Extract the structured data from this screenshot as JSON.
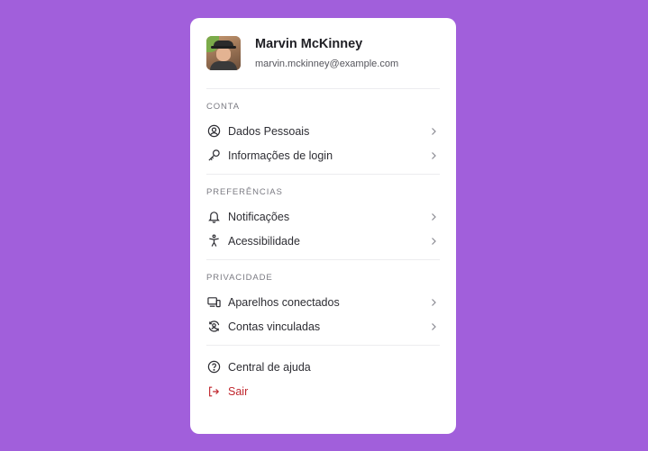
{
  "profile": {
    "name": "Marvin McKinney",
    "email": "marvin.mckinney@example.com"
  },
  "sections": [
    {
      "title": "CONTA",
      "items": [
        {
          "label": "Dados Pessoais",
          "icon": "user-circle-icon"
        },
        {
          "label": "Informações de login",
          "icon": "key-icon"
        }
      ]
    },
    {
      "title": "PREFERÊNCIAS",
      "items": [
        {
          "label": "Notificações",
          "icon": "bell-icon"
        },
        {
          "label": "Acessibilidade",
          "icon": "accessibility-icon"
        }
      ]
    },
    {
      "title": "PRIVACIDADE",
      "items": [
        {
          "label": "Aparelhos conectados",
          "icon": "devices-icon"
        },
        {
          "label": "Contas vinculadas",
          "icon": "linked-accounts-icon"
        }
      ]
    }
  ],
  "footer": {
    "help_label": "Central de ajuda",
    "logout_label": "Sair"
  },
  "colors": {
    "background": "#a15fdb",
    "card": "#ffffff",
    "danger": "#c0262d"
  }
}
